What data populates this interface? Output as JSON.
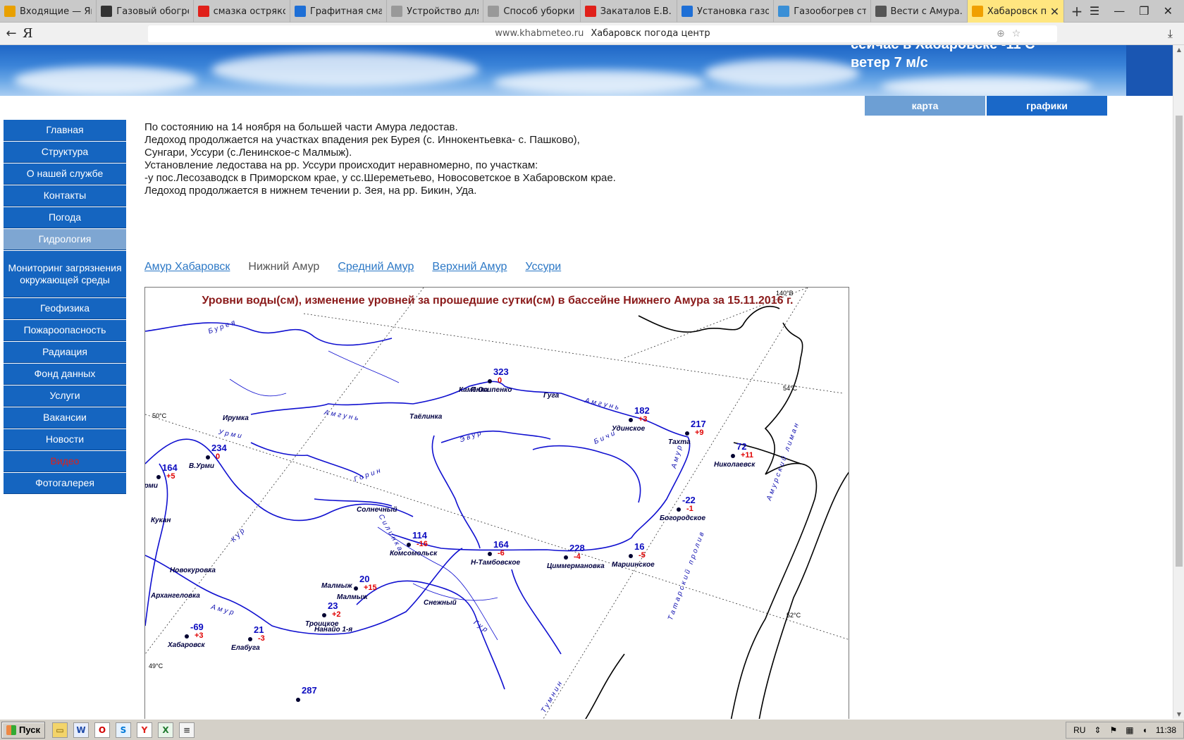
{
  "browser": {
    "tabs": [
      {
        "label": "Входящие — Янд",
        "icon": "mail-icon",
        "color": "#e8a000"
      },
      {
        "label": "Газовый обогрев",
        "icon": "bolt-icon",
        "color": "#333333"
      },
      {
        "label": "смазка остряков",
        "icon": "yandex-icon",
        "color": "#e0201a"
      },
      {
        "label": "Графитная смазк",
        "icon": "site-icon",
        "color": "#1e6fd6"
      },
      {
        "label": "Устройство для с",
        "icon": "page-icon",
        "color": "#999999"
      },
      {
        "label": "Способ уборки с",
        "icon": "page-icon",
        "color": "#999999"
      },
      {
        "label": "Закаталов Е.В. ·",
        "icon": "yandex-icon",
        "color": "#e0201a"
      },
      {
        "label": "Установка газов",
        "icon": "site-icon",
        "color": "#1e6fd6"
      },
      {
        "label": "Газообогрев стре",
        "icon": "site-icon",
        "color": "#3a8fd6"
      },
      {
        "label": "Вести с Амура.Зе",
        "icon": "news-icon",
        "color": "#555555"
      },
      {
        "label": "Хабаровск пог",
        "icon": "site-icon",
        "color": "#f0a000",
        "active": true
      }
    ],
    "address": {
      "domain": "www.khabmeteo.ru",
      "title": "Хабаровск погода центр"
    },
    "ya_logo": "Я"
  },
  "banner": {
    "weather_line1": "сейчас в Хабаровске -11 С",
    "weather_line2": "ветер 7 м/с"
  },
  "map_tabs": [
    "карта",
    "графики"
  ],
  "nav": [
    {
      "label": "Главная"
    },
    {
      "label": "Структура"
    },
    {
      "label": "О нашей службе"
    },
    {
      "label": "Контакты"
    },
    {
      "label": "Погода"
    },
    {
      "label": "Гидрология",
      "active": true
    },
    {
      "label": "Мониторинг загрязнения окружающей среды"
    },
    {
      "label": "Геофизика"
    },
    {
      "label": "Пожароопасность"
    },
    {
      "label": "Радиация"
    },
    {
      "label": "Фонд данных"
    },
    {
      "label": "Услуги"
    },
    {
      "label": "Вакансии"
    },
    {
      "label": "Новости"
    },
    {
      "label": "Видео",
      "red": true
    },
    {
      "label": "Фотогалерея"
    }
  ],
  "bulletin": [
    "По состоянию на 14 ноября на большей части Амура ледостав.",
    "Ледоход продолжается на участках впадения рек Бурея (с. Иннокентьевка- с. Пашково),",
    "Сунгари, Уссури (с.Ленинское-с Малмыж).",
    "Установление ледостава на рр. Уссури происходит неравномерно, по участкам:",
    "-у пос.Лесозаводск в Приморском крае, у сс.Шереметьево, Новосоветское в Хабаровском крае.",
    "Ледоход продолжается в нижнем течении р. Зея, на рр. Бикин, Уда."
  ],
  "region_links": [
    {
      "label": "Амур Хабаровск",
      "link": true
    },
    {
      "label": "Нижний Амур",
      "link": false
    },
    {
      "label": "Средний Амур",
      "link": true
    },
    {
      "label": "Верхний Амур",
      "link": true
    },
    {
      "label": "Уссури",
      "link": true
    }
  ],
  "map": {
    "title": "Уровни воды(см), изменение уровней за прошедшие сутки(см) в бассейне Нижнего Амура за 15.11.2016 г.",
    "grid_labels": {
      "lon140": "140°В",
      "lat54": "54°С",
      "lat50": "50°С",
      "lat52": "52°С",
      "lat49": "49°С"
    },
    "stations": [
      {
        "name": "П.Осипенко",
        "level": "323",
        "change": "0"
      },
      {
        "name": "Удинское",
        "level": "182",
        "change": "+3"
      },
      {
        "name": "Тахта",
        "level": "217",
        "change": "+9"
      },
      {
        "name": "Николаевск",
        "level": "72",
        "change": "+11"
      },
      {
        "name": "Богородское",
        "level": "-22",
        "change": "-1"
      },
      {
        "name": "В.Урми",
        "level": "234",
        "change": "0"
      },
      {
        "name": "Урми",
        "level": "164",
        "change": "+5"
      },
      {
        "name": "Комсомольск",
        "level": "114",
        "change": "-16"
      },
      {
        "name": "Н-Тамбовское",
        "level": "164",
        "change": "-6"
      },
      {
        "name": "Циммермановка",
        "level": "228",
        "change": "-4"
      },
      {
        "name": "Мариинское",
        "level": "16",
        "change": "-5"
      },
      {
        "name": "Малмыж",
        "level": "20",
        "change": "+15"
      },
      {
        "name": "Троицкое",
        "level": "23",
        "change": "+2"
      },
      {
        "name": "Хабаровск",
        "level": "-69",
        "change": "+3"
      },
      {
        "name": "Елабуга",
        "level": "21",
        "change": "-3"
      },
      {
        "name": "",
        "level": "287",
        "change": ""
      }
    ],
    "places": [
      "Каменка",
      "Гуга",
      "Ирумка",
      "Таёлинка",
      "Солнечный",
      "Кукан",
      "Новокуровка",
      "Архангеловка",
      "Снежный",
      "Нанайо 1-я",
      "Малмыж"
    ],
    "rivers": [
      "Бурея",
      "Амгунь",
      "Амгунь",
      "Урми",
      "Эвур",
      "Бичи",
      "Горин",
      "Кур",
      "Амур",
      "Амур",
      "Гур",
      "Тумнин",
      "Амурский лиман",
      "Татарский пролив",
      "Силинка"
    ]
  },
  "taskbar": {
    "start": "Пуск",
    "lang": "RU",
    "time": "11:38"
  }
}
